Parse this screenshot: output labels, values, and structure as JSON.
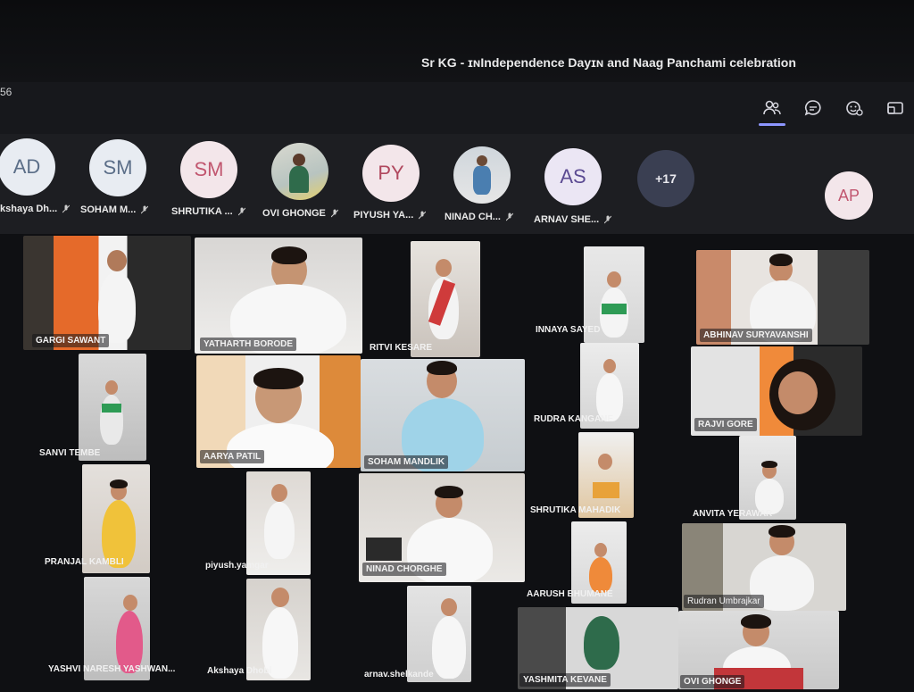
{
  "window": {
    "title": "Sr KG - ɪɴIndependence Dayɪɴ and Naag Panchami celebration",
    "timer": "56"
  },
  "toolbar": {
    "icons": [
      "people-icon",
      "chat-icon",
      "reactions-icon",
      "share-icon"
    ],
    "active": "people-icon",
    "accent_color": "#8d96ff"
  },
  "strip": {
    "participants": [
      {
        "initials": "AD",
        "name": "kshaya Dh..."
      },
      {
        "initials": "SM",
        "name": "SOHAM M..."
      },
      {
        "initials": "SM",
        "name": "SHRUTIKA ..."
      },
      {
        "initials": "",
        "name": "OVI GHONGE"
      },
      {
        "initials": "PY",
        "name": "PIYUSH YA..."
      },
      {
        "initials": "",
        "name": "NINAD CH..."
      },
      {
        "initials": "AS",
        "name": "ARNAV SHE..."
      }
    ],
    "more": "+17",
    "self_initials": "AP"
  },
  "grid": {
    "tiles": [
      {
        "name": "GARGI SAWANT"
      },
      {
        "name": "YATHARTH BORODE"
      },
      {
        "name": "RITVI KESARE"
      },
      {
        "name": "INNAYA SAYED"
      },
      {
        "name": "ABHINAV SURYAVANSHI"
      },
      {
        "name": "SANVI TEMBE"
      },
      {
        "name": "AARYA PATIL"
      },
      {
        "name": "SOHAM MANDLIK"
      },
      {
        "name": "RUDRA KANGANE"
      },
      {
        "name": "RAJVI GORE"
      },
      {
        "name": "SHRUTIKA MAHADIK"
      },
      {
        "name": "ANVITA YERAWAR"
      },
      {
        "name": "PRANJAL KAMBLI"
      },
      {
        "name": "piyush.yamgar"
      },
      {
        "name": "NINAD CHORGHE"
      },
      {
        "name": "AARUSH BHUMANE"
      },
      {
        "name": "Rudran Umbrajkar"
      },
      {
        "name": "YASHVI NARESH YASHWAN..."
      },
      {
        "name": "Akshaya Dhobi"
      },
      {
        "name": "arnav.shelkande"
      },
      {
        "name": "YASHMITA KEVANE"
      },
      {
        "name": "OVI GHONGE"
      }
    ]
  }
}
